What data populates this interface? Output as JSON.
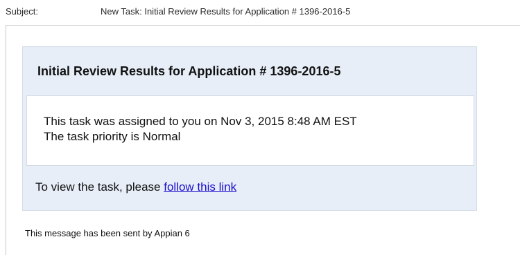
{
  "header": {
    "subject_label": "Subject:",
    "subject_value": "New Task: Initial Review Results for Application # 1396-2016-5"
  },
  "message": {
    "title": "Initial Review Results for Application # 1396-2016-5",
    "assigned_line": "This task was assigned to you on Nov 3, 2015 8:48 AM EST",
    "priority_line": "The task priority is Normal",
    "view_prefix": "To view the task, please ",
    "link_text": "follow this link",
    "sent_by": "This message has been sent by Appian 6"
  },
  "colors": {
    "card_background": "#e7eef8",
    "link": "#1a0dcc"
  }
}
